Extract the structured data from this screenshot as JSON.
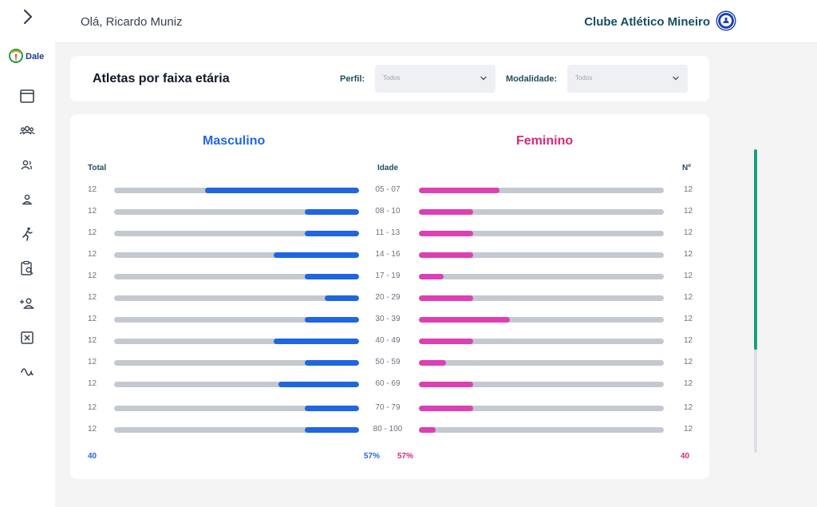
{
  "header": {
    "greeting": "Olá, Ricardo Muniz",
    "club_name": "Clube Atlético Mineiro"
  },
  "sidebar": {
    "logo_text": "Dale",
    "items": [
      {
        "icon": "calendar-icon"
      },
      {
        "icon": "group-icon"
      },
      {
        "icon": "users-icon"
      },
      {
        "icon": "user-icon"
      },
      {
        "icon": "running-icon"
      },
      {
        "icon": "clipboard-search-icon"
      },
      {
        "icon": "add-user-icon"
      },
      {
        "icon": "close-square-icon"
      },
      {
        "icon": "wave-icon"
      }
    ]
  },
  "filters": {
    "title": "Atletas por faixa etária",
    "perfil_label": "Perfil:",
    "perfil_value": "Todos",
    "modalidade_label": "Modalidade:",
    "modalidade_value": "Todos"
  },
  "chart": {
    "masculino_title": "Masculino",
    "feminino_title": "Feminino",
    "total_header": "Total",
    "age_header": "Idade",
    "count_header": "Nº",
    "footer_m_total": "40",
    "footer_m_pct": "57%",
    "footer_f_pct": "57%",
    "footer_f_total": "40",
    "colors": {
      "masculino": "#1f66e0",
      "feminino": "#dd3fb5",
      "track": "#c4c9d1"
    }
  },
  "chart_data": {
    "type": "bar",
    "categories": [
      "05 - 07",
      "08 - 10",
      "11 - 13",
      "14 - 16",
      "17 - 19",
      "20 - 29",
      "30 - 39",
      "40 - 49",
      "50 - 59",
      "60 - 69",
      "70 - 79",
      "80 - 100"
    ],
    "masculino_totals": [
      "12",
      "12",
      "12",
      "12",
      "12",
      "12",
      "12",
      "12",
      "12",
      "12",
      "12",
      "12"
    ],
    "feminino_counts": [
      "12",
      "12",
      "12",
      "12",
      "12",
      "12",
      "12",
      "12",
      "12",
      "12",
      "12",
      "12"
    ],
    "series": [
      {
        "name": "Masculino",
        "values": [
          0.63,
          0.22,
          0.22,
          0.35,
          0.22,
          0.14,
          0.22,
          0.35,
          0.22,
          0.33,
          0.22,
          0.22
        ]
      },
      {
        "name": "Feminino",
        "values": [
          0.33,
          0.22,
          0.22,
          0.22,
          0.1,
          0.22,
          0.37,
          0.22,
          0.11,
          0.22,
          0.22,
          0.07
        ]
      }
    ]
  }
}
